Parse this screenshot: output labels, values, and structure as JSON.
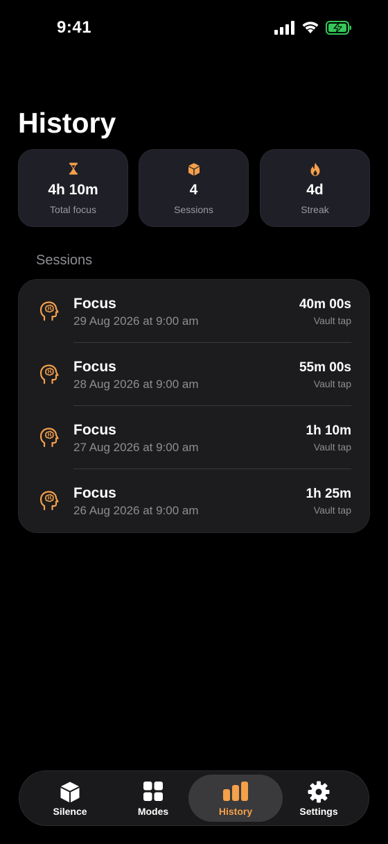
{
  "status_bar": {
    "time": "9:41"
  },
  "page": {
    "title": "History"
  },
  "stats": [
    {
      "icon": "hourglass-icon",
      "value": "4h 10m",
      "label": "Total focus"
    },
    {
      "icon": "cube-icon",
      "value": "4",
      "label": "Sessions"
    },
    {
      "icon": "flame-icon",
      "value": "4d",
      "label": "Streak"
    }
  ],
  "sessions_section": {
    "header": "Sessions",
    "rows": [
      {
        "icon": "brain-head-icon",
        "title": "Focus",
        "date": "29 Aug 2026 at 9:00 am",
        "duration": "40m 00s",
        "method": "Vault tap"
      },
      {
        "icon": "brain-head-icon",
        "title": "Focus",
        "date": "28 Aug 2026 at 9:00 am",
        "duration": "55m 00s",
        "method": "Vault tap"
      },
      {
        "icon": "brain-head-icon",
        "title": "Focus",
        "date": "27 Aug 2026 at 9:00 am",
        "duration": "1h 10m",
        "method": "Vault tap"
      },
      {
        "icon": "brain-head-icon",
        "title": "Focus",
        "date": "26 Aug 2026 at 9:00 am",
        "duration": "1h 25m",
        "method": "Vault tap"
      }
    ]
  },
  "tab_bar": {
    "tabs": [
      {
        "icon": "cube-icon",
        "label": "Silence",
        "selected": false
      },
      {
        "icon": "grid-icon",
        "label": "Modes",
        "selected": false
      },
      {
        "icon": "bar-chart-icon",
        "label": "History",
        "selected": true
      },
      {
        "icon": "gear-icon",
        "label": "Settings",
        "selected": false
      }
    ]
  },
  "colors": {
    "accent": "#f5a04a",
    "background": "#000000",
    "card": "#1f1f27",
    "list_bg": "#1c1c1e",
    "secondary_text": "#8e8e93",
    "battery": "#34c759"
  }
}
